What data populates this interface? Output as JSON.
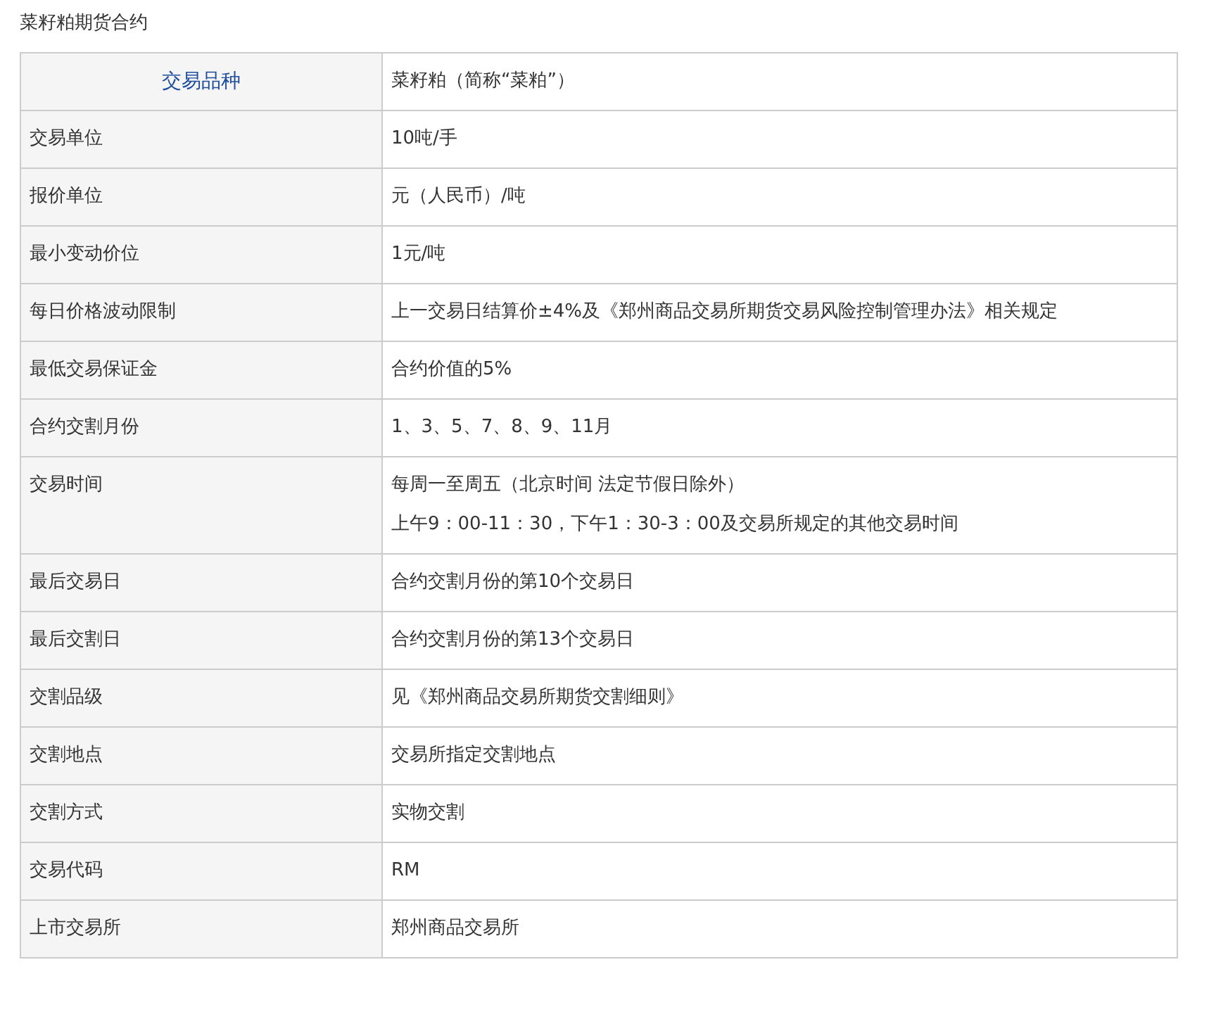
{
  "title": "菜籽粕期货合约",
  "rows": [
    {
      "kind": "header",
      "label": "交易品种",
      "values": [
        "菜籽粕（简称“菜粕”）"
      ]
    },
    {
      "kind": "normal",
      "label": "交易单位",
      "values": [
        "10吨/手"
      ]
    },
    {
      "kind": "normal",
      "label": "报价单位",
      "values": [
        "元（人民币）/吨"
      ]
    },
    {
      "kind": "normal",
      "label": "最小变动价位",
      "values": [
        "1元/吨"
      ]
    },
    {
      "kind": "normal",
      "label": "每日价格波动限制",
      "values": [
        "上一交易日结算价±4%及《郑州商品交易所期货交易风险控制管理办法》相关规定"
      ]
    },
    {
      "kind": "normal",
      "label": "最低交易保证金",
      "values": [
        "合约价值的5%"
      ]
    },
    {
      "kind": "normal",
      "label": "合约交割月份",
      "values": [
        "1、3、5、7、8、9、11月"
      ]
    },
    {
      "kind": "normal",
      "label": "交易时间",
      "values": [
        "每周一至周五（北京时间 法定节假日除外）",
        "上午9：00-11：30，下午1：30-3：00及交易所规定的其他交易时间"
      ]
    },
    {
      "kind": "normal",
      "label": "最后交易日",
      "values": [
        "合约交割月份的第10个交易日"
      ]
    },
    {
      "kind": "normal",
      "label": "最后交割日",
      "values": [
        "合约交割月份的第13个交易日"
      ]
    },
    {
      "kind": "normal",
      "label": "交割品级",
      "values": [
        "见《郑州商品交易所期货交割细则》"
      ]
    },
    {
      "kind": "normal",
      "label": "交割地点",
      "values": [
        "交易所指定交割地点"
      ]
    },
    {
      "kind": "normal",
      "label": "交割方式",
      "values": [
        "实物交割"
      ]
    },
    {
      "kind": "normal",
      "label": "交易代码",
      "values": [
        "RM"
      ]
    },
    {
      "kind": "normal",
      "label": "上市交易所",
      "values": [
        "郑州商品交易所"
      ]
    }
  ]
}
